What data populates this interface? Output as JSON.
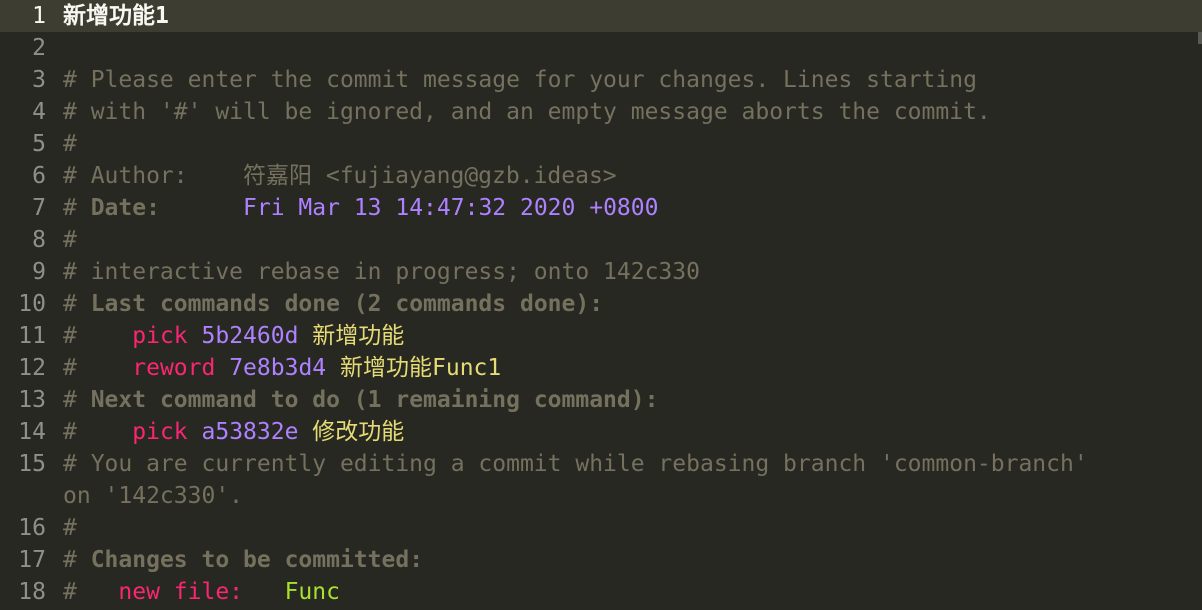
{
  "editor": {
    "lines": [
      {
        "num": "1"
      },
      {
        "num": "2"
      },
      {
        "num": "3",
        "text": "# Please enter the commit message for your changes. Lines starting"
      },
      {
        "num": "4",
        "text": "# with '#' will be ignored, and an empty message aborts the commit."
      },
      {
        "num": "5",
        "text": "#"
      },
      {
        "num": "6",
        "label": "# Author:    ",
        "value": "符嘉阳 <fujiayang@gzb.ideas>"
      },
      {
        "num": "7",
        "hash": "# ",
        "label": "Date:",
        "pad": "      ",
        "value": "Fri Mar 13 14:47:32 2020 +0800"
      },
      {
        "num": "8",
        "text": "#"
      },
      {
        "num": "9",
        "text": "# interactive rebase in progress; onto 142c330"
      },
      {
        "num": "10",
        "hash": "# ",
        "label": "Last commands done (2 commands done):"
      },
      {
        "num": "11",
        "hash": "#    ",
        "cmd": "pick",
        "sha": "5b2460d",
        "msg": "新增功能"
      },
      {
        "num": "12",
        "hash": "#    ",
        "cmd": "reword",
        "sha": "7e8b3d4",
        "msg": "新增功能Func1"
      },
      {
        "num": "13",
        "hash": "# ",
        "label": "Next command to do (1 remaining command):"
      },
      {
        "num": "14",
        "hash": "#    ",
        "cmd": "pick",
        "sha": "a53832e",
        "msg": "修改功能"
      },
      {
        "num": "15",
        "text": "# You are currently editing a commit while rebasing branch 'common-branch'",
        "cont": "on '142c330'."
      },
      {
        "num": "16",
        "text": "#"
      },
      {
        "num": "17",
        "hash": "# ",
        "label": "Changes to be committed:"
      },
      {
        "num": "18",
        "hash": "#   ",
        "kind": "new file:",
        "pad": "   ",
        "file": "Func"
      }
    ],
    "commit_message": "新增功能1"
  },
  "colors": {
    "background": "#272822",
    "comment": "#75715e",
    "keyword": "#f92672",
    "constant": "#ae81ff",
    "string": "#e6db74",
    "entity": "#a6e22e",
    "foreground": "#f8f8f2"
  }
}
